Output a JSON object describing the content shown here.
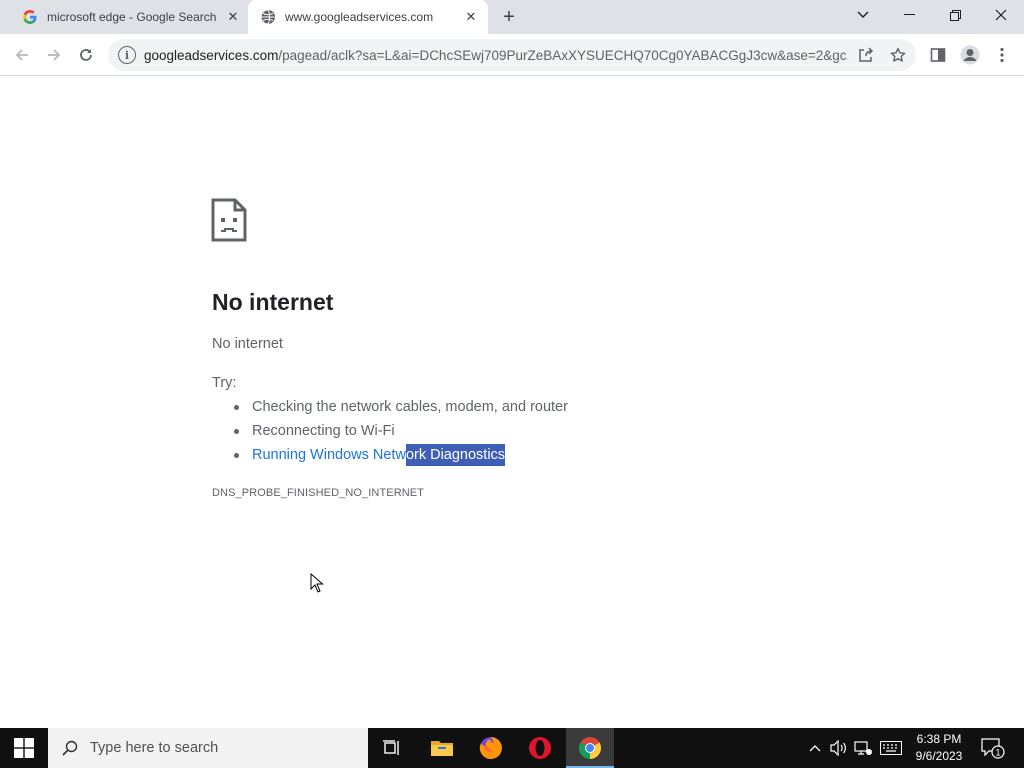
{
  "browser": {
    "tabs": [
      {
        "title": "microsoft edge - Google Search",
        "favicon": "google-g-icon",
        "active": false
      },
      {
        "title": "www.googleadservices.com",
        "favicon": "globe-icon",
        "active": true
      }
    ],
    "new_tab_label": "+",
    "address": {
      "host": "googleadservices.com",
      "path": "/pagead/aclk?sa=L&ai=DChcSEwj709PurZeBAxXYSUECHQ70Cg0YABACGgJ3cw&ase=2&gc..."
    }
  },
  "page": {
    "title": "No internet",
    "subtitle": "No internet",
    "try_label": "Try:",
    "suggestions": [
      {
        "text": "Checking the network cables, modem, and router"
      },
      {
        "text": "Reconnecting to Wi-Fi"
      },
      {
        "text_unselected": "Running Windows Netw",
        "text_selected": "ork Diagnostics"
      }
    ],
    "error_code": "DNS_PROBE_FINISHED_NO_INTERNET"
  },
  "taskbar": {
    "search_placeholder": "Type here to search",
    "apps": [
      "task-view",
      "file-explorer",
      "firefox",
      "opera",
      "chrome"
    ],
    "clock": {
      "time": "6:38 PM",
      "date": "9/6/2023"
    },
    "notification_count": "1"
  },
  "colors": {
    "accent": "#1a73e8",
    "selection": "#3f5fb7",
    "taskbar": "#101010"
  }
}
